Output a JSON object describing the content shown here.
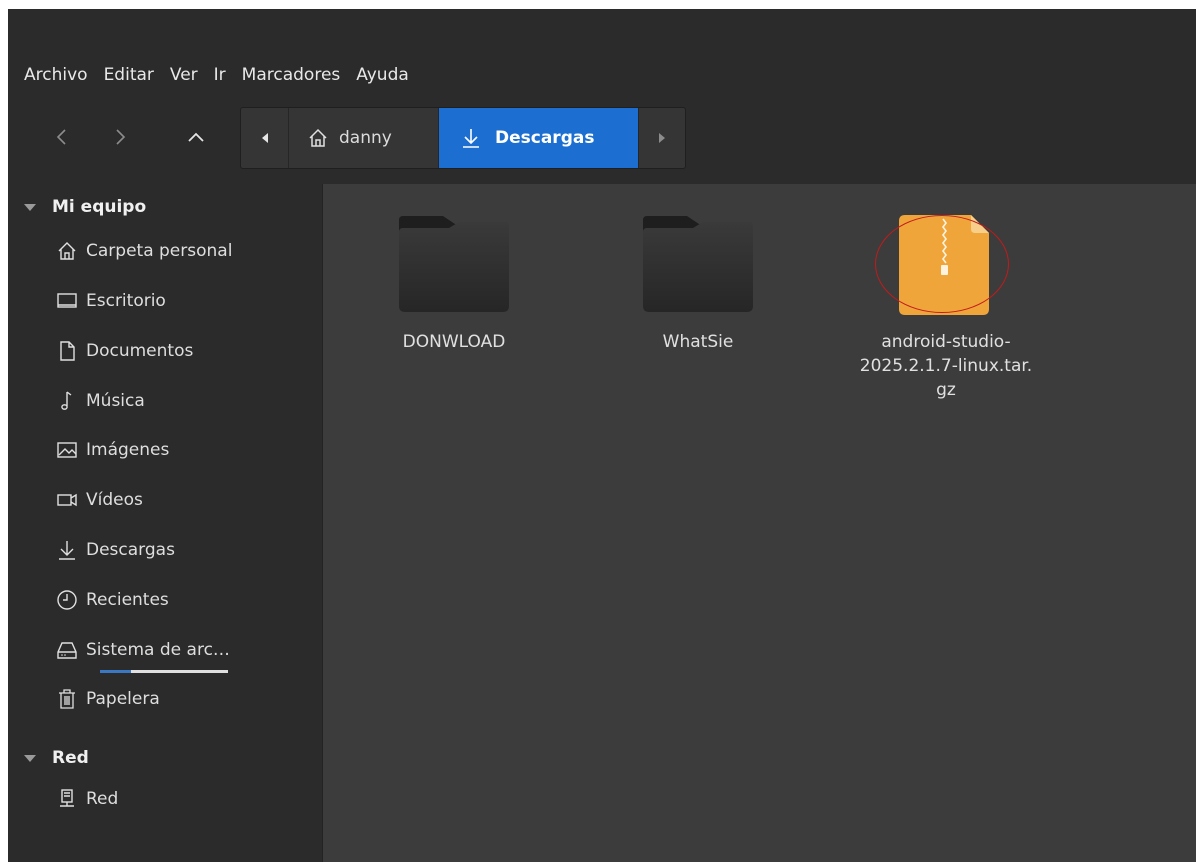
{
  "menubar": {
    "items": [
      "Archivo",
      "Editar",
      "Ver",
      "Ir",
      "Marcadores",
      "Ayuda"
    ]
  },
  "toolbar": {
    "back_icon": "chevron-left-icon",
    "forward_icon": "chevron-right-icon",
    "up_icon": "chevron-up-icon",
    "crumbs": [
      {
        "label": "danny",
        "icon": "home-icon"
      },
      {
        "label": "Descargas",
        "icon": "download-icon",
        "current": true
      }
    ]
  },
  "sidebar": {
    "sections": [
      {
        "title": "Mi equipo",
        "items": [
          {
            "label": "Carpeta personal",
            "icon": "home-icon"
          },
          {
            "label": "Escritorio",
            "icon": "desktop-icon"
          },
          {
            "label": "Documentos",
            "icon": "document-icon"
          },
          {
            "label": "Música",
            "icon": "music-icon"
          },
          {
            "label": "Imágenes",
            "icon": "image-icon"
          },
          {
            "label": "Vídeos",
            "icon": "video-icon"
          },
          {
            "label": "Descargas",
            "icon": "download-icon"
          },
          {
            "label": "Recientes",
            "icon": "clock-icon"
          },
          {
            "label": "Sistema de arc…",
            "icon": "drive-icon",
            "usage": 0.24
          },
          {
            "label": "Papelera",
            "icon": "trash-icon"
          }
        ]
      },
      {
        "title": "Red",
        "items": [
          {
            "label": "Red",
            "icon": "network-icon"
          }
        ]
      }
    ]
  },
  "files": [
    {
      "name": "DONWLOAD",
      "type": "folder"
    },
    {
      "name": "WhatSie",
      "type": "folder"
    },
    {
      "name_lines": [
        "android-studio-",
        "2025.2.1.7-linux.tar.",
        "gz"
      ],
      "type": "archive",
      "highlighted": true
    }
  ],
  "colors": {
    "accent": "#1c6fd1",
    "archive": "#f0a53a",
    "highlight_ring": "#c21b1b"
  }
}
